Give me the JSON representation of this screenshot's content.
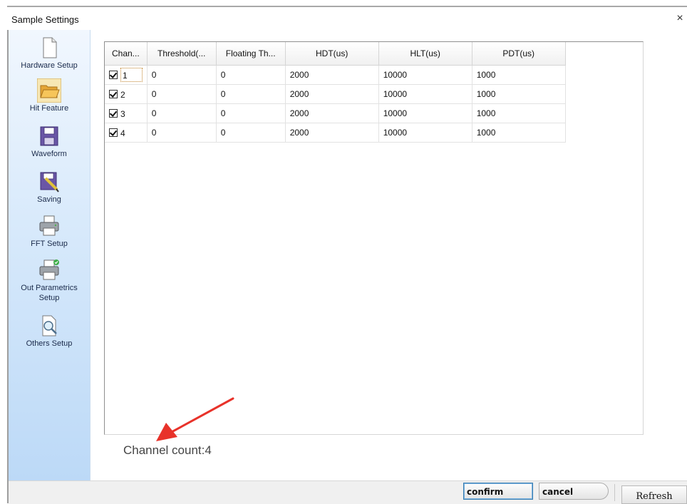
{
  "window": {
    "title": "Sample Settings",
    "close_glyph": "×"
  },
  "sidebar": {
    "items": [
      {
        "label": "Hardware Setup",
        "icon": "blank-page-icon"
      },
      {
        "label": "Hit Feature",
        "icon": "folder-open-icon"
      },
      {
        "label": "Waveform",
        "icon": "floppy-disk-icon"
      },
      {
        "label": "Saving",
        "icon": "disk-with-pencil-icon"
      },
      {
        "label": "FFT Setup",
        "icon": "printer-icon"
      },
      {
        "label": "Out Parametrics Setup",
        "icon": "printer-check-icon"
      },
      {
        "label": "Others Setup",
        "icon": "page-magnifier-icon"
      }
    ]
  },
  "grid": {
    "columns": [
      "Chan...",
      "Threshold(...",
      "Floating Th...",
      "HDT(us)",
      "HLT(us)",
      "PDT(us)"
    ],
    "rows": [
      {
        "checked": true,
        "channel": "1",
        "threshold": "0",
        "floating": "0",
        "hdt": "2000",
        "hlt": "10000",
        "pdt": "1000"
      },
      {
        "checked": true,
        "channel": "2",
        "threshold": "0",
        "floating": "0",
        "hdt": "2000",
        "hlt": "10000",
        "pdt": "1000"
      },
      {
        "checked": true,
        "channel": "3",
        "threshold": "0",
        "floating": "0",
        "hdt": "2000",
        "hlt": "10000",
        "pdt": "1000"
      },
      {
        "checked": true,
        "channel": "4",
        "threshold": "0",
        "floating": "0",
        "hdt": "2000",
        "hlt": "10000",
        "pdt": "1000"
      }
    ]
  },
  "channel_count_text": "Channel count:4",
  "buttons": {
    "confirm": "confirm",
    "cancel": "cancel",
    "refresh": "Refresh"
  },
  "colors": {
    "sidebar_top": "#f1f7fe",
    "sidebar_bottom": "#bcd9f7",
    "arrow": "#e8322a",
    "confirm_border": "#3c7fb1"
  }
}
